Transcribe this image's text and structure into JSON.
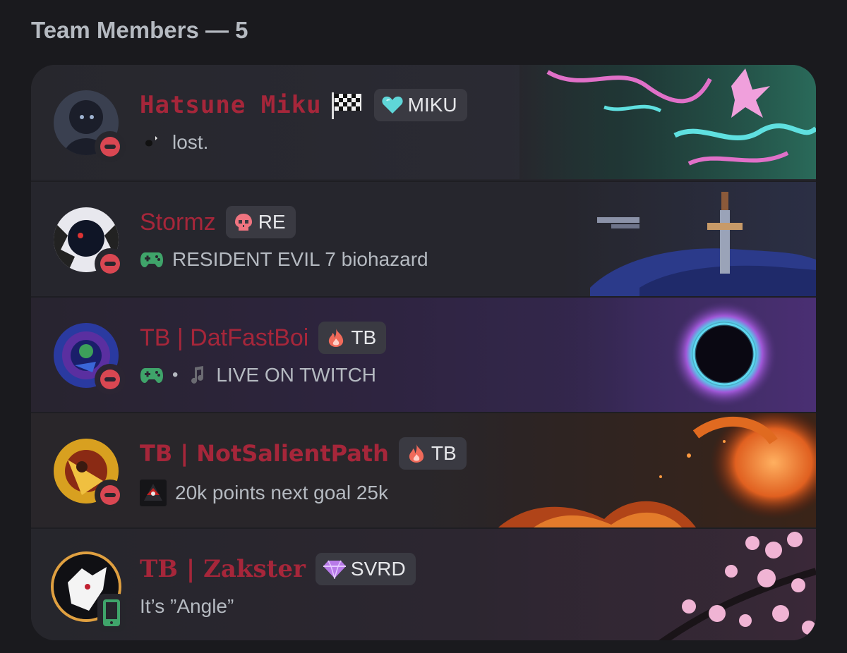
{
  "section": {
    "title": "Team Members — 5"
  },
  "colors": {
    "name_red": "#a6263a",
    "dnd_red": "#d94752",
    "online_green": "#3fa46a",
    "game_green": "#3fa46a"
  },
  "members": [
    {
      "name": "Hatsune Miku",
      "name_style": "pixel",
      "status": "do-not-disturb",
      "has_flag_icon": true,
      "tag": {
        "icon": "heart-icon",
        "label": "MIKU"
      },
      "activity": {
        "icon": "custom-emoji-icon",
        "text": "lost."
      }
    },
    {
      "name": "Stormz",
      "status": "do-not-disturb",
      "tag": {
        "icon": "skull-icon",
        "label": "RE"
      },
      "activity": {
        "icon": "gamepad-icon",
        "text": "RESIDENT EVIL 7 biohazard"
      }
    },
    {
      "name": "TB | DatFastBoi",
      "status": "do-not-disturb",
      "tag": {
        "icon": "flame-icon",
        "label": "TB"
      },
      "activity": {
        "icon": "gamepad-icon",
        "separator": "•",
        "icon2": "music-note-icon",
        "text": "LIVE ON TWITCH"
      }
    },
    {
      "name": "TB | NotSalientPath",
      "name_style": "bold",
      "status": "do-not-disturb",
      "tag": {
        "icon": "flame-icon",
        "label": "TB"
      },
      "activity": {
        "icon": "custom-emoji-icon",
        "text": "20k points next goal 25k"
      }
    },
    {
      "name": "TB | Zakster",
      "name_style": "serif",
      "status": "mobile-online",
      "tag": {
        "icon": "gem-icon",
        "label": "SVRD"
      },
      "activity": {
        "text": "It’s ”Angle”"
      }
    }
  ]
}
